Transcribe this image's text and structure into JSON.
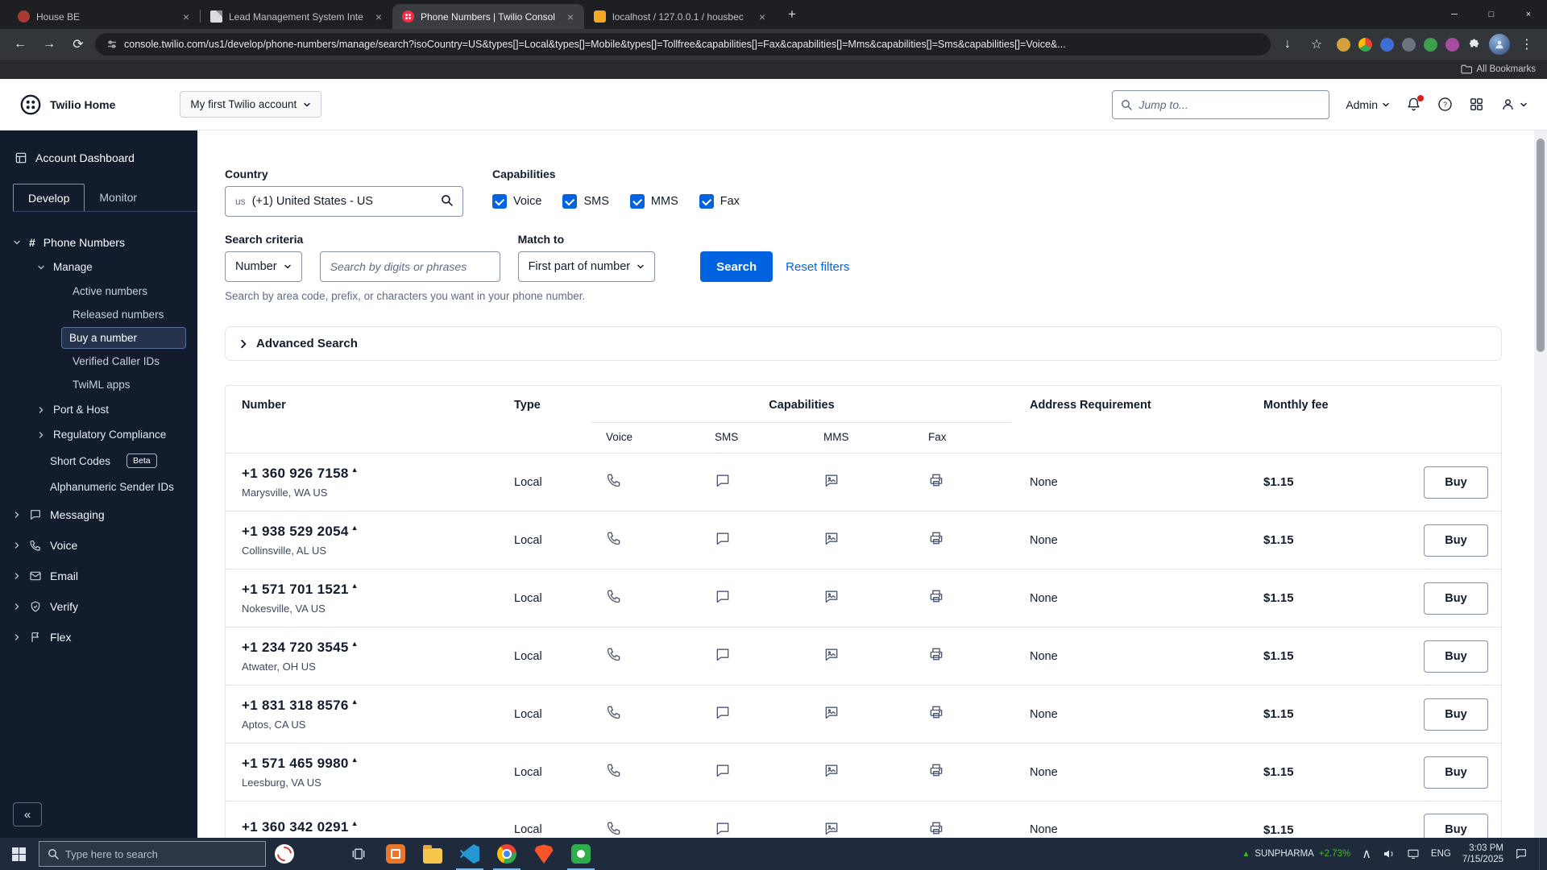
{
  "icons": {
    "caret_up": "▲",
    "collapse": "«",
    "plus": "+",
    "close": "×",
    "minimize": "─",
    "maximize": "□",
    "kebab": "⋮",
    "star": "☆",
    "back": "←",
    "forward": "→",
    "reload": "⟳",
    "download": "↓",
    "tray_up": "∧"
  },
  "colors": {
    "accent": "#0263E0",
    "sidebar_bg": "#121C2D",
    "link": "#0263E0",
    "positive": "#43B929",
    "twilio_red": "#F22F46"
  },
  "browser": {
    "tabs": [
      {
        "label": "House BE"
      },
      {
        "label": "Lead Management System Inte"
      },
      {
        "label": "Phone Numbers | Twilio Consol"
      },
      {
        "label": "localhost / 127.0.0.1 / housbec"
      }
    ],
    "url": "console.twilio.com/us1/develop/phone-numbers/manage/search?isoCountry=US&types[]=Local&types[]=Mobile&types[]=Tollfree&capabilities[]=Fax&capabilities[]=Mms&capabilities[]=Sms&capabilities[]=Voice&...",
    "bookmarks_label": "All Bookmarks"
  },
  "header": {
    "home": "Twilio Home",
    "account": "My first Twilio account",
    "jump_placeholder": "Jump to...",
    "admin": "Admin"
  },
  "sidebar": {
    "dashboard": "Account Dashboard",
    "develop": "Develop",
    "monitor": "Monitor",
    "phone_numbers": "Phone Numbers",
    "manage": "Manage",
    "manage_items": [
      {
        "label": "Active numbers"
      },
      {
        "label": "Released numbers"
      },
      {
        "label": "Buy a number"
      },
      {
        "label": "Verified Caller IDs"
      },
      {
        "label": "TwiML apps"
      }
    ],
    "port_host": "Port & Host",
    "regulatory": "Regulatory Compliance",
    "short_codes": "Short Codes",
    "beta": "Beta",
    "alphanumeric": "Alphanumeric Sender IDs",
    "sections": [
      {
        "label": "Messaging"
      },
      {
        "label": "Voice"
      },
      {
        "label": "Email"
      },
      {
        "label": "Verify"
      },
      {
        "label": "Flex"
      }
    ]
  },
  "filters": {
    "country_label": "Country",
    "country_flag": "us",
    "country_value": "(+1) United States - US",
    "capabilities_label": "Capabilities",
    "capabilities": [
      {
        "label": "Voice",
        "checked": true
      },
      {
        "label": "SMS",
        "checked": true
      },
      {
        "label": "MMS",
        "checked": true
      },
      {
        "label": "Fax",
        "checked": true
      }
    ],
    "criteria_label": "Search criteria",
    "criteria_value": "Number",
    "search_placeholder": "Search by digits or phrases",
    "match_label": "Match to",
    "match_value": "First part of number",
    "search_button": "Search",
    "reset_link": "Reset filters",
    "helper": "Search by area code, prefix, or characters you want in your phone number."
  },
  "advanced_search": "Advanced Search",
  "table": {
    "headers": {
      "number": "Number",
      "type": "Type",
      "capabilities": "Capabilities",
      "sub": [
        "Voice",
        "SMS",
        "MMS",
        "Fax"
      ],
      "address": "Address Requirement",
      "fee": "Monthly fee"
    },
    "buy": "Buy",
    "rows": [
      {
        "number": "+1 360 926 7158",
        "location": "Marysville, WA US",
        "type": "Local",
        "address": "None",
        "fee": "$1.15"
      },
      {
        "number": "+1 938 529 2054",
        "location": "Collinsville, AL US",
        "type": "Local",
        "address": "None",
        "fee": "$1.15"
      },
      {
        "number": "+1 571 701 1521",
        "location": "Nokesville, VA US",
        "type": "Local",
        "address": "None",
        "fee": "$1.15"
      },
      {
        "number": "+1 234 720 3545",
        "location": "Atwater, OH US",
        "type": "Local",
        "address": "None",
        "fee": "$1.15"
      },
      {
        "number": "+1 831 318 8576",
        "location": "Aptos, CA US",
        "type": "Local",
        "address": "None",
        "fee": "$1.15"
      },
      {
        "number": "+1 571 465 9980",
        "location": "Leesburg, VA US",
        "type": "Local",
        "address": "None",
        "fee": "$1.15"
      },
      {
        "number": "+1 360 342 0291",
        "location": "",
        "type": "Local",
        "address": "None",
        "fee": "$1.15"
      }
    ]
  },
  "taskbar": {
    "search_placeholder": "Type here to search",
    "stock": "SUNPHARMA",
    "stock_change": "+2.73%",
    "lang": "ENG",
    "time": "3:03 PM",
    "date": "7/15/2025"
  }
}
